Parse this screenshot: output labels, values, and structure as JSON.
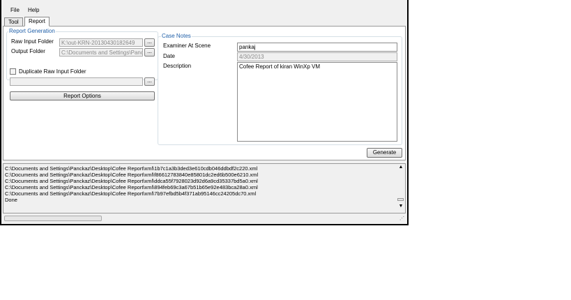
{
  "menu": {
    "file": "File",
    "help": "Help"
  },
  "tabs": [
    {
      "label": "Tool"
    },
    {
      "label": "Report"
    }
  ],
  "report_generation": {
    "legend": "Report Generation",
    "raw_input_label": "Raw Input Folder",
    "raw_input_value": "K:\\out-KRN-20130430182649",
    "output_label": "Output Folder",
    "output_value": "C:\\Documents and Settings\\Panck",
    "browse_label": "...",
    "duplicate_label": "Duplicate Raw Input Folder",
    "duplicate_value": "",
    "report_options_label": "Report Options"
  },
  "case_notes": {
    "legend": "Case Notes",
    "examiner_label": "Examiner At Scene",
    "examiner_value": "pankaj",
    "date_label": "Date",
    "date_value": "4/30/2013",
    "description_label": "Description",
    "description_value": "Cofee Report of kiran WinXp VM"
  },
  "generate_label": "Generate",
  "log_lines": [
    "C:\\Documents and Settings\\Panckaz\\Desktop\\Cofee Report\\xml\\1b7c1a3b3ded3e610cdb046ddbdf2c220.xml",
    "C:\\Documents and Settings\\Panckaz\\Desktop\\Cofee Report\\xml\\f86612783840e85801dc2ed6b500e6210.xml",
    "C:\\Documents and Settings\\Panckaz\\Desktop\\Cofee Report\\xml\\ddca55f7928023d92d6a9cd35337bd5a0.xml",
    "C:\\Documents and Settings\\Panckaz\\Desktop\\Cofee Report\\xml\\894feb69c3a67b51b65e92e483bca28a0.xml",
    "C:\\Documents and Settings\\Panckaz\\Desktop\\Cofee Report\\xml\\7b97efbd5b4f371ab95146cc24205dc70.xml",
    "Done"
  ],
  "icons": {
    "scroll_up": "▲",
    "scroll_down": "▼",
    "resize_grip": "⋰"
  }
}
